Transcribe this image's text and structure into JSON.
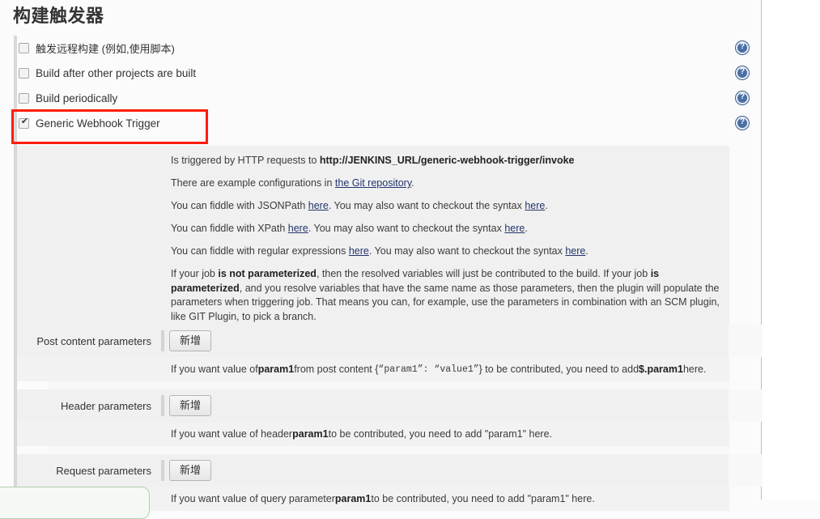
{
  "page": {
    "title": "构建触发器"
  },
  "triggers": [
    {
      "label": "触发远程构建 (例如,使用脚本)",
      "checked": false,
      "help": "help-icon"
    },
    {
      "label": "Build after other projects are built",
      "checked": false,
      "help": "help-icon"
    },
    {
      "label": "Build periodically",
      "checked": false,
      "help": "help-icon"
    },
    {
      "label": "Generic Webhook Trigger",
      "checked": true,
      "help": "help-icon"
    }
  ],
  "description": {
    "line1_prefix": "Is triggered by HTTP requests to ",
    "line1_url": "http://JENKINS_URL/generic-webhook-trigger/invoke",
    "line2_prefix": "There are example configurations in ",
    "line2_link": "the Git repository",
    "line2_suffix": ".",
    "line3_prefix": "You can fiddle with JSONPath ",
    "line3_link1": "here",
    "line3_mid": ". You may also want to checkout the syntax ",
    "line3_link2": "here",
    "line3_suffix": ".",
    "line4_prefix": "You can fiddle with XPath ",
    "line4_link1": "here",
    "line4_mid": ". You may also want to checkout the syntax ",
    "line4_link2": "here",
    "line4_suffix": ".",
    "line5_prefix": "You can fiddle with regular expressions ",
    "line5_link1": "here",
    "line5_mid": ". You may also want to checkout the syntax ",
    "line5_link2": "here",
    "line5_suffix": ".",
    "para_1": "If your job ",
    "para_bold_1": "is not parameterized",
    "para_2": ", then the resolved variables will just be contributed to the build. If your job ",
    "para_bold_2": "is parameterized",
    "para_3": ", and you resolve variables that have the same name as those parameters, then the plugin will populate the parameters when triggering job. That means you can, for example, use the parameters in combination with an SCM plugin, like GIT Plugin, to pick a branch."
  },
  "parameters": [
    {
      "label": "Post content parameters",
      "button": "新增",
      "help_1": "If you want value of ",
      "help_bold_1": "param1",
      "help_2": " from post content { ",
      "help_mono_1": "“param1”: “value1”",
      "help_3": " } to be contributed, you need to add ",
      "help_bold_2": "$.param1",
      "help_4": " here."
    },
    {
      "label": "Header parameters",
      "button": "新增",
      "help_1": "If you want value of header ",
      "help_bold_1": "param1",
      "help_2": " to be contributed, you need to add \"param1\" here.",
      "help_mono_1": "",
      "help_3": "",
      "help_bold_2": "",
      "help_4": ""
    },
    {
      "label": "Request parameters",
      "button": "新增",
      "help_1": "If you want value of query parameter ",
      "help_bold_1": "param1",
      "help_2": " to be contributed, you need to add \"param1\" here.",
      "help_mono_1": "",
      "help_3": "",
      "help_bold_2": "",
      "help_4": ""
    }
  ],
  "colors": {
    "highlight": "#fc1d08",
    "link": "#22346b",
    "panel": "#f0f0f0",
    "help_icon": "#4a6fa5"
  }
}
